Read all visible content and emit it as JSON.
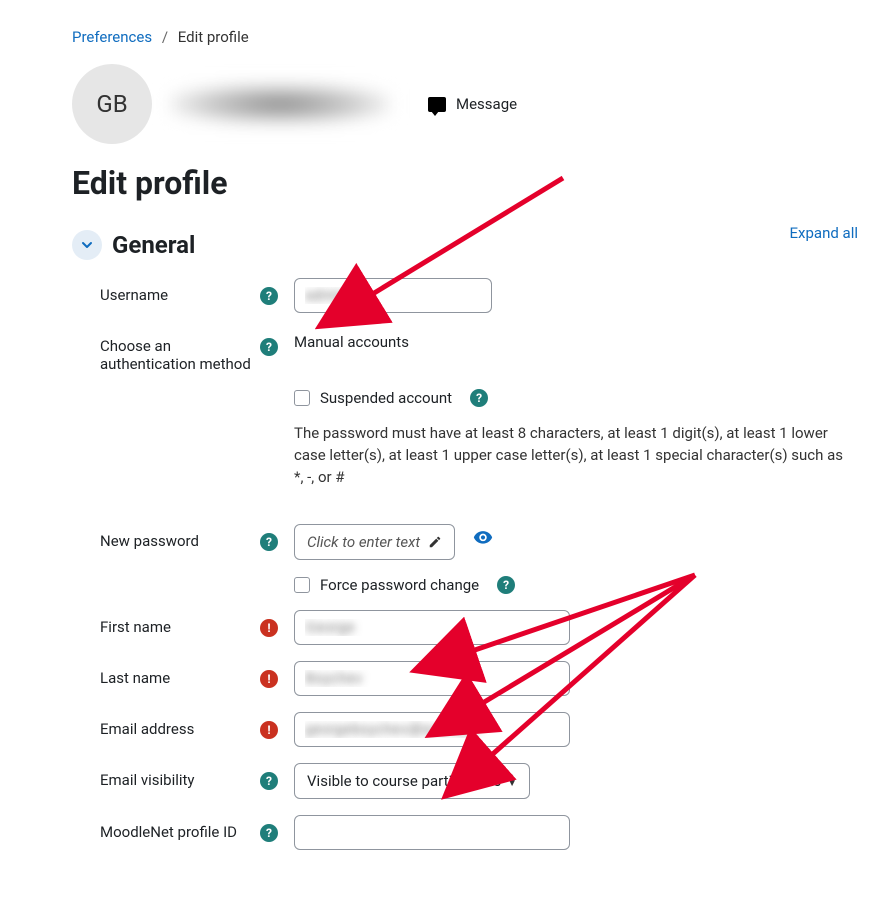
{
  "breadcrumb": {
    "preferences": "Preferences",
    "current": "Edit profile"
  },
  "avatar_initials": "GB",
  "message_label": "Message",
  "page_title": "Edit profile",
  "expand_all": "Expand all",
  "section_general": "General",
  "rows": {
    "username_label": "Username",
    "auth_label": "Choose an authentication method",
    "auth_value": "Manual accounts",
    "suspended_label": "Suspended account",
    "password_policy": "The password must have at least 8 characters, at least 1 digit(s), at least 1 lower case letter(s), at least 1 upper case letter(s), at least 1 special character(s) such as *, -, or #",
    "newpw_label": "New password",
    "newpw_click": "Click to enter text",
    "forcepw_label": "Force password change",
    "firstname_label": "First name",
    "lastname_label": "Last name",
    "email_label": "Email address",
    "emailvis_label": "Email visibility",
    "emailvis_value": "Visible to course participants",
    "moodlenet_label": "MoodleNet profile ID"
  }
}
